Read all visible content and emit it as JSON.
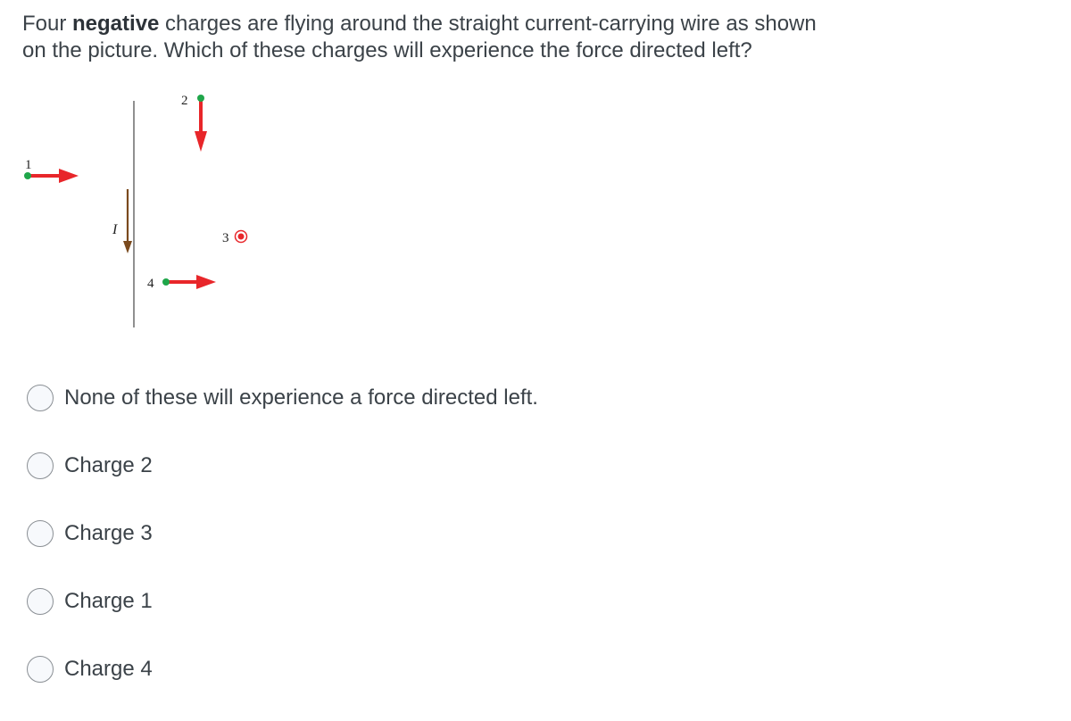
{
  "question": {
    "prefix": "Four ",
    "emphasis": "negative",
    "suffix_line1": " charges are flying around the straight current-carrying wire as shown",
    "line2": "on the picture. Which of these charges will experience the force directed left?"
  },
  "figure": {
    "current_label": "I",
    "colors": {
      "wire": "#555555",
      "current_arrow": "#7a4a1e",
      "velocity_arrow": "#e8262a",
      "charge_dot": "#1fa64a",
      "out_of_page_symbol": "#e8262a"
    },
    "charges": [
      {
        "label": "1",
        "velocity_direction": "right"
      },
      {
        "label": "2",
        "velocity_direction": "down"
      },
      {
        "label": "3",
        "velocity_direction": "out-of-page"
      },
      {
        "label": "4",
        "velocity_direction": "right"
      }
    ],
    "current_direction": "down"
  },
  "options": [
    {
      "label": "None of these will experience a force directed left.",
      "selected": false
    },
    {
      "label": "Charge 2",
      "selected": false
    },
    {
      "label": "Charge 3",
      "selected": false
    },
    {
      "label": "Charge 1",
      "selected": false
    },
    {
      "label": "Charge 4",
      "selected": false
    }
  ]
}
